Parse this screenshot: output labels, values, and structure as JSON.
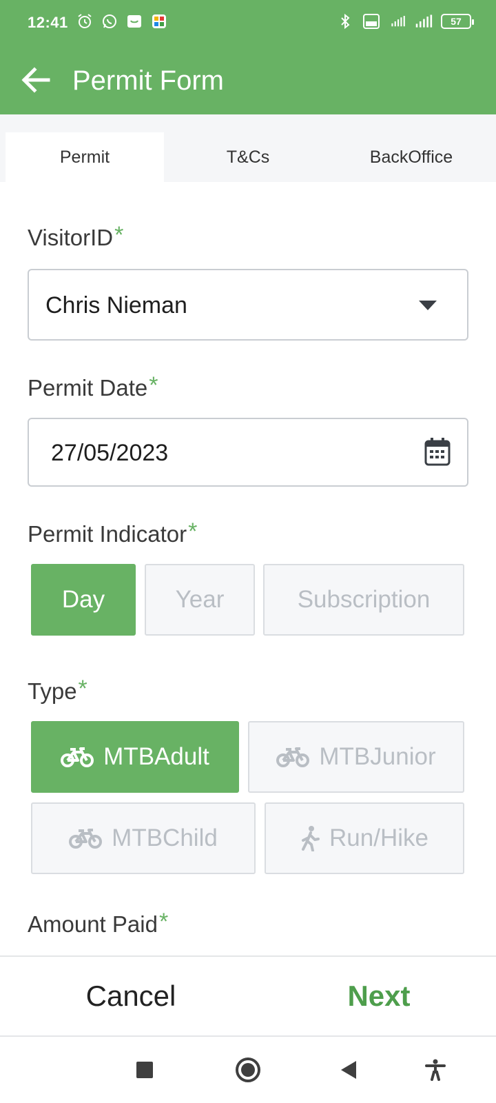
{
  "status_bar": {
    "time": "12:41",
    "battery": "57",
    "icons_left": [
      "alarm-icon",
      "whatsapp-icon",
      "smile-app-icon",
      "grid-app-icon"
    ],
    "icons_right": [
      "bluetooth-icon",
      "volte-icon",
      "signal-4g-icon",
      "signal-icon",
      "battery-icon"
    ]
  },
  "app_bar": {
    "title": "Permit Form",
    "back_icon": "arrow-left-icon",
    "color": "#68b264"
  },
  "tabs": [
    {
      "label": "Permit",
      "active": true
    },
    {
      "label": "T&Cs",
      "active": false
    },
    {
      "label": "BackOffice",
      "active": false
    }
  ],
  "form": {
    "required_mark": "*",
    "visitor": {
      "label": "VisitorID",
      "value": "Chris Nieman"
    },
    "permit_date": {
      "label": "Permit Date",
      "value": "27/05/2023"
    },
    "permit_indicator": {
      "label": "Permit Indicator",
      "options": [
        "Day",
        "Year",
        "Subscription"
      ],
      "selected": "Day"
    },
    "type": {
      "label": "Type",
      "options": [
        "MTBAdult",
        "MTBJunior",
        "MTBChild",
        "Run/Hike"
      ],
      "selected": "MTBAdult"
    },
    "amount_paid": {
      "label": "Amount Paid"
    }
  },
  "actions": {
    "cancel": "Cancel",
    "next": "Next"
  },
  "colors": {
    "accent": "#68b264",
    "next_text": "#4e9e4c",
    "unselected_bg": "#f6f7f9"
  }
}
